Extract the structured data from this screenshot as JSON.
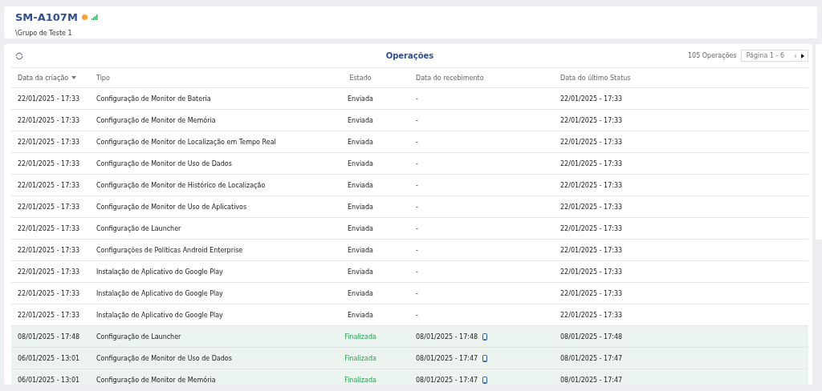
{
  "device": {
    "name": "SM-A107M",
    "group": "\\Grupo de Teste 1"
  },
  "operations": {
    "title": "Operações",
    "count": "105 Operações",
    "page": "Página 1 - 6",
    "columns": [
      {
        "label": "Data da criação",
        "sorted": true
      },
      {
        "label": "Tipo",
        "sorted": false
      },
      {
        "label": "Estado",
        "sorted": false
      },
      {
        "label": "Data do recebimento",
        "sorted": false
      },
      {
        "label": "Data do último Status",
        "sorted": false
      }
    ],
    "rows": [
      {
        "created": "22/01/2025 - 17:33",
        "type": "Configuração de Monitor de Bateria",
        "kind": "sent",
        "state": "Enviada",
        "received": "-",
        "last": "22/01/2025 - 17:33"
      },
      {
        "created": "22/01/2025 - 17:33",
        "type": "Configuração de Monitor de Memória",
        "kind": "sent",
        "state": "Enviada",
        "received": "-",
        "last": "22/01/2025 - 17:33"
      },
      {
        "created": "22/01/2025 - 17:33",
        "type": "Configuração de Monitor de Localização em Tempo Real",
        "kind": "sent",
        "state": "Enviada",
        "received": "-",
        "last": "22/01/2025 - 17:33"
      },
      {
        "created": "22/01/2025 - 17:33",
        "type": "Configuração de Monitor de Uso de Dados",
        "kind": "sent",
        "state": "Enviada",
        "received": "-",
        "last": "22/01/2025 - 17:33"
      },
      {
        "created": "22/01/2025 - 17:33",
        "type": "Configuração de Monitor de Histórico de Localização",
        "kind": "sent",
        "state": "Enviada",
        "received": "-",
        "last": "22/01/2025 - 17:33"
      },
      {
        "created": "22/01/2025 - 17:33",
        "type": "Configuração de Monitor de Uso de Aplicativos",
        "kind": "sent",
        "state": "Enviada",
        "received": "-",
        "last": "22/01/2025 - 17:33"
      },
      {
        "created": "22/01/2025 - 17:33",
        "type": "Configuração de Launcher",
        "kind": "sent",
        "state": "Enviada",
        "received": "-",
        "last": "22/01/2025 - 17:33"
      },
      {
        "created": "22/01/2025 - 17:33",
        "type": "Configurações de Políticas Android Enterprise",
        "kind": "sent",
        "state": "Enviada",
        "received": "-",
        "last": "22/01/2025 - 17:33"
      },
      {
        "created": "22/01/2025 - 17:33",
        "type": "Instalação de Aplicativo do Google Play",
        "kind": "sent",
        "state": "Enviada",
        "received": "-",
        "last": "22/01/2025 - 17:33"
      },
      {
        "created": "22/01/2025 - 17:33",
        "type": "Instalação de Aplicativo do Google Play",
        "kind": "sent",
        "state": "Enviada",
        "received": "-",
        "last": "22/01/2025 - 17:33"
      },
      {
        "created": "22/01/2025 - 17:33",
        "type": "Instalação de Aplicativo do Google Play",
        "kind": "sent",
        "state": "Enviada",
        "received": "-",
        "last": "22/01/2025 - 17:33"
      },
      {
        "created": "08/01/2025 - 17:48",
        "type": "Configuração de Launcher",
        "kind": "finished",
        "state": "Finalizada",
        "received": "08/01/2025 - 17:48",
        "last": "08/01/2025 - 17:48"
      },
      {
        "created": "06/01/2025 - 13:01",
        "type": "Configuração de Monitor de Uso de Dados",
        "kind": "finished",
        "state": "Finalizada",
        "received": "08/01/2025 - 17:47",
        "last": "08/01/2025 - 17:47"
      },
      {
        "created": "06/01/2025 - 13:01",
        "type": "Configuração de Monitor de Memória",
        "kind": "finished",
        "state": "Finalizada",
        "received": "08/01/2025 - 17:47",
        "last": "08/01/2025 - 17:47"
      }
    ]
  }
}
